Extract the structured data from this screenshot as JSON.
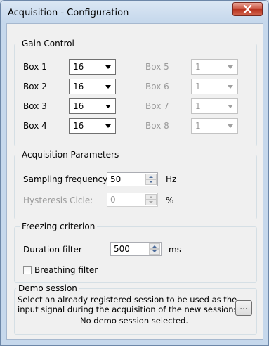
{
  "window": {
    "title": "Acquisition - Configuration"
  },
  "gain_control": {
    "legend": "Gain Control",
    "boxes": [
      {
        "label": "Box 1",
        "value": "16",
        "enabled": true
      },
      {
        "label": "Box 2",
        "value": "16",
        "enabled": true
      },
      {
        "label": "Box 3",
        "value": "16",
        "enabled": true
      },
      {
        "label": "Box 4",
        "value": "16",
        "enabled": true
      },
      {
        "label": "Box 5",
        "value": "1",
        "enabled": false
      },
      {
        "label": "Box 6",
        "value": "1",
        "enabled": false
      },
      {
        "label": "Box 7",
        "value": "1",
        "enabled": false
      },
      {
        "label": "Box 8",
        "value": "1",
        "enabled": false
      }
    ]
  },
  "acquisition_parameters": {
    "legend": "Acquisition Parameters",
    "sampling_frequency": {
      "label": "Sampling frequency",
      "value": "50",
      "unit": "Hz"
    },
    "hysteresis": {
      "label": "Hysteresis Cicle:",
      "value": "0",
      "unit": "%"
    }
  },
  "freezing_criterion": {
    "legend": "Freezing criterion",
    "duration_filter": {
      "label": "Duration filter",
      "value": "500",
      "unit": "ms"
    },
    "breathing_filter": {
      "label": "Breathing filter",
      "checked": false
    }
  },
  "demo_session": {
    "legend": "Demo session",
    "description_line1": "Select an already registered session to be used as the",
    "description_line2": "input signal during the acquisition of the new sessions.",
    "status": "No demo session selected.",
    "browse_label": "..."
  }
}
